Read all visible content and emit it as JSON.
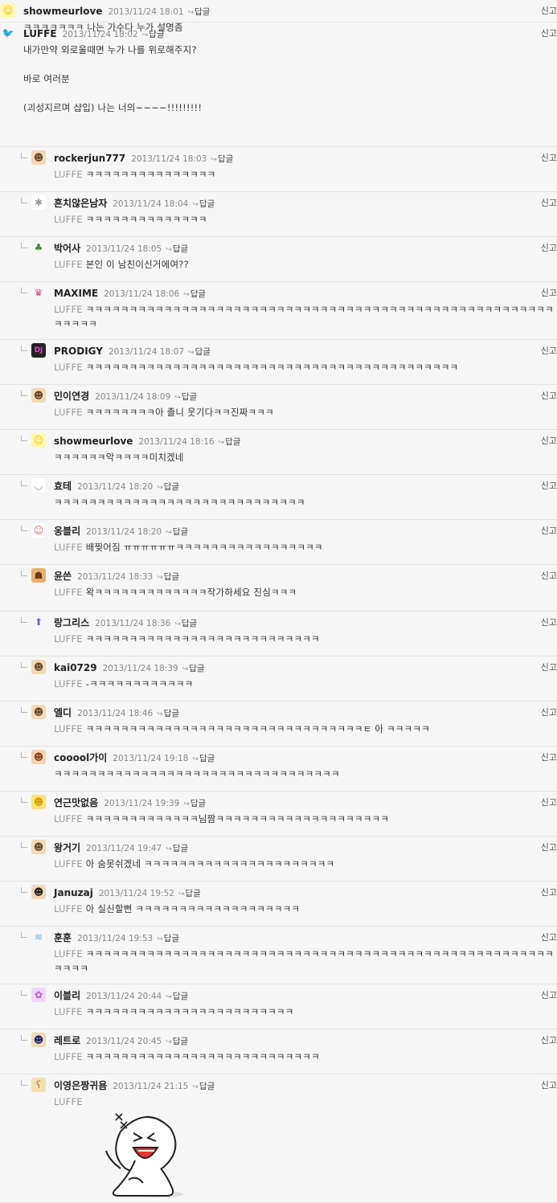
{
  "comments": [
    {
      "nick": "showmeurlove",
      "date": "2013/11/24 18:01",
      "reply": "답글",
      "report": "신고",
      "tag": "",
      "paras": [
        "ㅋㅋㅋㅋㅋㅋㅋ 나는 가수다 누가 설명좀"
      ],
      "avatar": "smile-face-icon"
    },
    {
      "nick": "LUFFE",
      "date": "2013/11/24 18:02",
      "reply": "답글",
      "report": "신고",
      "tag": "",
      "paras": [
        "내가만약 외로울때면 누가 나를 위로해주지?",
        "바로 여러분",
        "(괴성지르며 샵입) 나는 너의~~~~!!!!!!!!!"
      ],
      "avatar": "blue-bird-icon"
    },
    {
      "nick": "rockerjun777",
      "date": "2013/11/24 18:03",
      "reply": "답글",
      "report": "신고",
      "tag": "LUFFE",
      "paras": [
        "ㅋㅋㅋㅋㅋㅋㅋㅋㅋㅋㅋㅋㅋㅋㅋ"
      ],
      "avatar": "glasses-face-icon"
    },
    {
      "nick": "흔치않은남자",
      "date": "2013/11/24 18:04",
      "reply": "답글",
      "report": "신고",
      "tag": "LUFFE",
      "paras": [
        "ㅋㅋㅋㅋㅋㅋㅋㅋㅋㅋㅋㅋㅋㅋ"
      ],
      "avatar": "white-spiky-icon"
    },
    {
      "nick": "박어사",
      "date": "2013/11/24 18:05",
      "reply": "답글",
      "report": "신고",
      "tag": "LUFFE",
      "paras": [
        "본인 이 남친이신거에여??"
      ],
      "avatar": "tree-icon"
    },
    {
      "nick": "MAXIME",
      "date": "2013/11/24 18:06",
      "reply": "답글",
      "report": "신고",
      "tag": "LUFFE",
      "paras": [
        "ㅋㅋㅋㅋㅋㅋㅋㅋㅋㅋㅋㅋㅋㅋㅋㅋㅋㅋㅋㅋㅋㅋㅋㅋㅋㅋㅋㅋㅋㅋㅋㅋㅋㅋㅋㅋㅋㅋㅋㅋㅋㅋㅋㅋㅋㅋㅋㅋㅋㅋㅋㅋㅋㅋㅋㅋㅋㅋㅋ"
      ],
      "avatar": "pink-crown-icon"
    },
    {
      "nick": "PRODIGY",
      "date": "2013/11/24 18:07",
      "reply": "답글",
      "report": "신고",
      "tag": "LUFFE",
      "paras": [
        "ㅋㅋㅋㅋㅋㅋㅋㅋㅋㅋㅋㅋㅋㅋㅋㅋㅋㅋㅋㅋㅋㅋㅋㅋㅋㅋㅋㅋㅋㅋㅋㅋㅋㅋㅋㅋㅋㅋㅋㅋㅋㅋㅋ"
      ],
      "avatar": "dj-icon"
    },
    {
      "nick": "민이연경",
      "date": "2013/11/24 18:09",
      "reply": "답글",
      "report": "신고",
      "tag": "LUFFE",
      "paras": [
        "ㅋㅋㅋㅋㅋㅋㅋㅋ아 졸니 웃기다ㅋㅋ진짜ㅋㅋㅋ"
      ],
      "avatar": "glasses-face-icon"
    },
    {
      "nick": "showmeurlove",
      "date": "2013/11/24 18:16",
      "reply": "답글",
      "report": "신고",
      "tag": "",
      "paras": [
        "ㅋㅋㅋㅋㅋㅋ악ㅋㅋㅋㅋ미치겠네"
      ],
      "avatar": "smile-face-icon"
    },
    {
      "nick": "효테",
      "date": "2013/11/24 18:20",
      "reply": "답글",
      "report": "신고",
      "tag": "",
      "paras": [
        "ㅋㅋㅋㅋㅋㅋㅋㅋㅋㅋㅋㅋㅋㅋㅋㅋㅋㅋㅋㅋㅋㅋㅋㅋㅋㅋㅋㅋㅋ"
      ],
      "avatar": "simple-smile-icon"
    },
    {
      "nick": "옹블리",
      "date": "2013/11/24 18:20",
      "reply": "답글",
      "report": "신고",
      "tag": "LUFFE",
      "paras": [
        "배찢어짐 ㅠㅠㅠㅠㅠㅠㅋㅋㅋㅋㅋㅋㅋㅋㅋㅋㅋㅋㅋㅋㅋㅋㅋ"
      ],
      "avatar": "blush-face-icon"
    },
    {
      "nick": "윤쓴",
      "date": "2013/11/24 18:33",
      "reply": "답글",
      "report": "신고",
      "tag": "LUFFE",
      "paras": [
        "왁ㅋㅋㅋㅋㅋㅋㅋㅋㅋㅋㅋㅋㅋ작가하세요 진심ㅋㅋㅋ"
      ],
      "avatar": "warrior-icon"
    },
    {
      "nick": "랑그리스",
      "date": "2013/11/24 18:36",
      "reply": "답글",
      "report": "신고",
      "tag": "LUFFE",
      "paras": [
        "ㅋㅋㅋㅋㅋㅋㅋㅋㅋㅋㅋㅋㅋㅋㅋㅋㅋㅋㅋㅋㅋㅋㅋㅋㅋㅋㅋ"
      ],
      "avatar": "up-arrow-icon"
    },
    {
      "nick": "kai0729",
      "date": "2013/11/24 18:39",
      "reply": "답글",
      "report": "신고",
      "tag": "LUFFE",
      "paras": [
        "-ㅋㅋㅋㅋㅋㅋㅋㅋㅋㅋㅋㅋ"
      ],
      "avatar": "glasses-face-icon"
    },
    {
      "nick": "엘디",
      "date": "2013/11/24 18:46",
      "reply": "답글",
      "report": "신고",
      "tag": "LUFFE",
      "paras": [
        "ㅋㅋㅋㅋㅋㅋㅋㅋㅋㅋㅋㅋㅋㅋㅋㅋㅋㅋㅋㅋㅋㅋㅋㅋㅋㅋㅋㅋㅋㅋㅋㅋㅌ 아 ㅋㅋㅋㅋㅋ"
      ],
      "avatar": "glasses-face-icon"
    },
    {
      "nick": "cooool가이",
      "date": "2013/11/24 19:18",
      "reply": "답글",
      "report": "신고",
      "tag": "",
      "paras": [
        "ㅋㅋㅋㅋㅋㅋㅋㅋㅋㅋㅋㅋㅋㅋㅋㅋㅋㅋㅋㅋㅋㅋㅋㅋㅋㅋㅋㅋㅋㅋㅋㅋㅋ"
      ],
      "avatar": "girl-face-icon"
    },
    {
      "nick": "연근맛없음",
      "date": "2013/11/24 19:39",
      "reply": "답글",
      "report": "신고",
      "tag": "LUFFE",
      "paras": [
        "ㅋㅋㅋㅋㅋㅋㅋㅋㅋㅋㅋㅋㅋ님짬ㅋㅋㅋㅋㅋㅋㅋㅋㅋㅋㅋㅋㅋㅋㅋㅋㅋㅋㅋㅋ"
      ],
      "avatar": "yellow-cat-icon"
    },
    {
      "nick": "왕거기",
      "date": "2013/11/24 19:47",
      "reply": "답글",
      "report": "신고",
      "tag": "LUFFE",
      "paras": [
        "아 숨못쉬겠네 ㅋㅋㅋㅋㅋㅋㅋㅋㅋㅋㅋㅋㅋㅋㅋㅋㅋㅋㅋㅋㅋㅋ"
      ],
      "avatar": "glasses-face-icon"
    },
    {
      "nick": "Januzaj",
      "date": "2013/11/24 19:52",
      "reply": "답글",
      "report": "신고",
      "tag": "LUFFE",
      "paras": [
        "아 실신할뻔 ㅋㅋㅋㅋㅋㅋㅋㅋㅋㅋㅋㅋㅋㅋㅋㅋㅋㅋㅋ"
      ],
      "avatar": "boy-face-icon"
    },
    {
      "nick": "훈훈",
      "date": "2013/11/24 19:53",
      "reply": "답글",
      "report": "신고",
      "tag": "LUFFE",
      "paras": [
        "ㅋㅋㅋㅋㅋㅋㅋㅋㅋㅋㅋㅋㅋㅋㅋㅋㅋㅋㅋㅋㅋㅋㅋㅋㅋㅋㅋㅋㅋㅋㅋㅋㅋㅋㅋㅋㅋㅋㅋㅋㅋㅋㅋㅋㅋㅋㅋㅋㅋㅋㅋㅋㅋㅋㅋㅋㅋㅋ"
      ],
      "avatar": "wind-icon"
    },
    {
      "nick": "이블리",
      "date": "2013/11/24 20:44",
      "reply": "답글",
      "report": "신고",
      "tag": "LUFFE",
      "paras": [
        "ㅋㅋㅋㅋㅋㅋㅋㅋㅋㅋㅋㅋㅋㅋㅋㅋㅋㅋㅋㅋㅋㅋㅋㅋ"
      ],
      "avatar": "purple-flower-icon"
    },
    {
      "nick": "레트로",
      "date": "2013/11/24 20:45",
      "reply": "답글",
      "report": "신고",
      "tag": "LUFFE",
      "paras": [
        "ㅋㅋㅋㅋㅋㅋㅋㅋㅋㅋㅋㅋㅋㅋㅋㅋㅋㅋㅋㅋㅋㅋㅋㅋㅋㅋㅋ"
      ],
      "avatar": "police-face-icon"
    },
    {
      "nick": "이영은짱귀욤",
      "date": "2013/11/24 21:15",
      "reply": "답글",
      "report": "신고",
      "tag": "LUFFE",
      "paras": [
        ""
      ],
      "avatar": "bear-face-icon"
    }
  ]
}
